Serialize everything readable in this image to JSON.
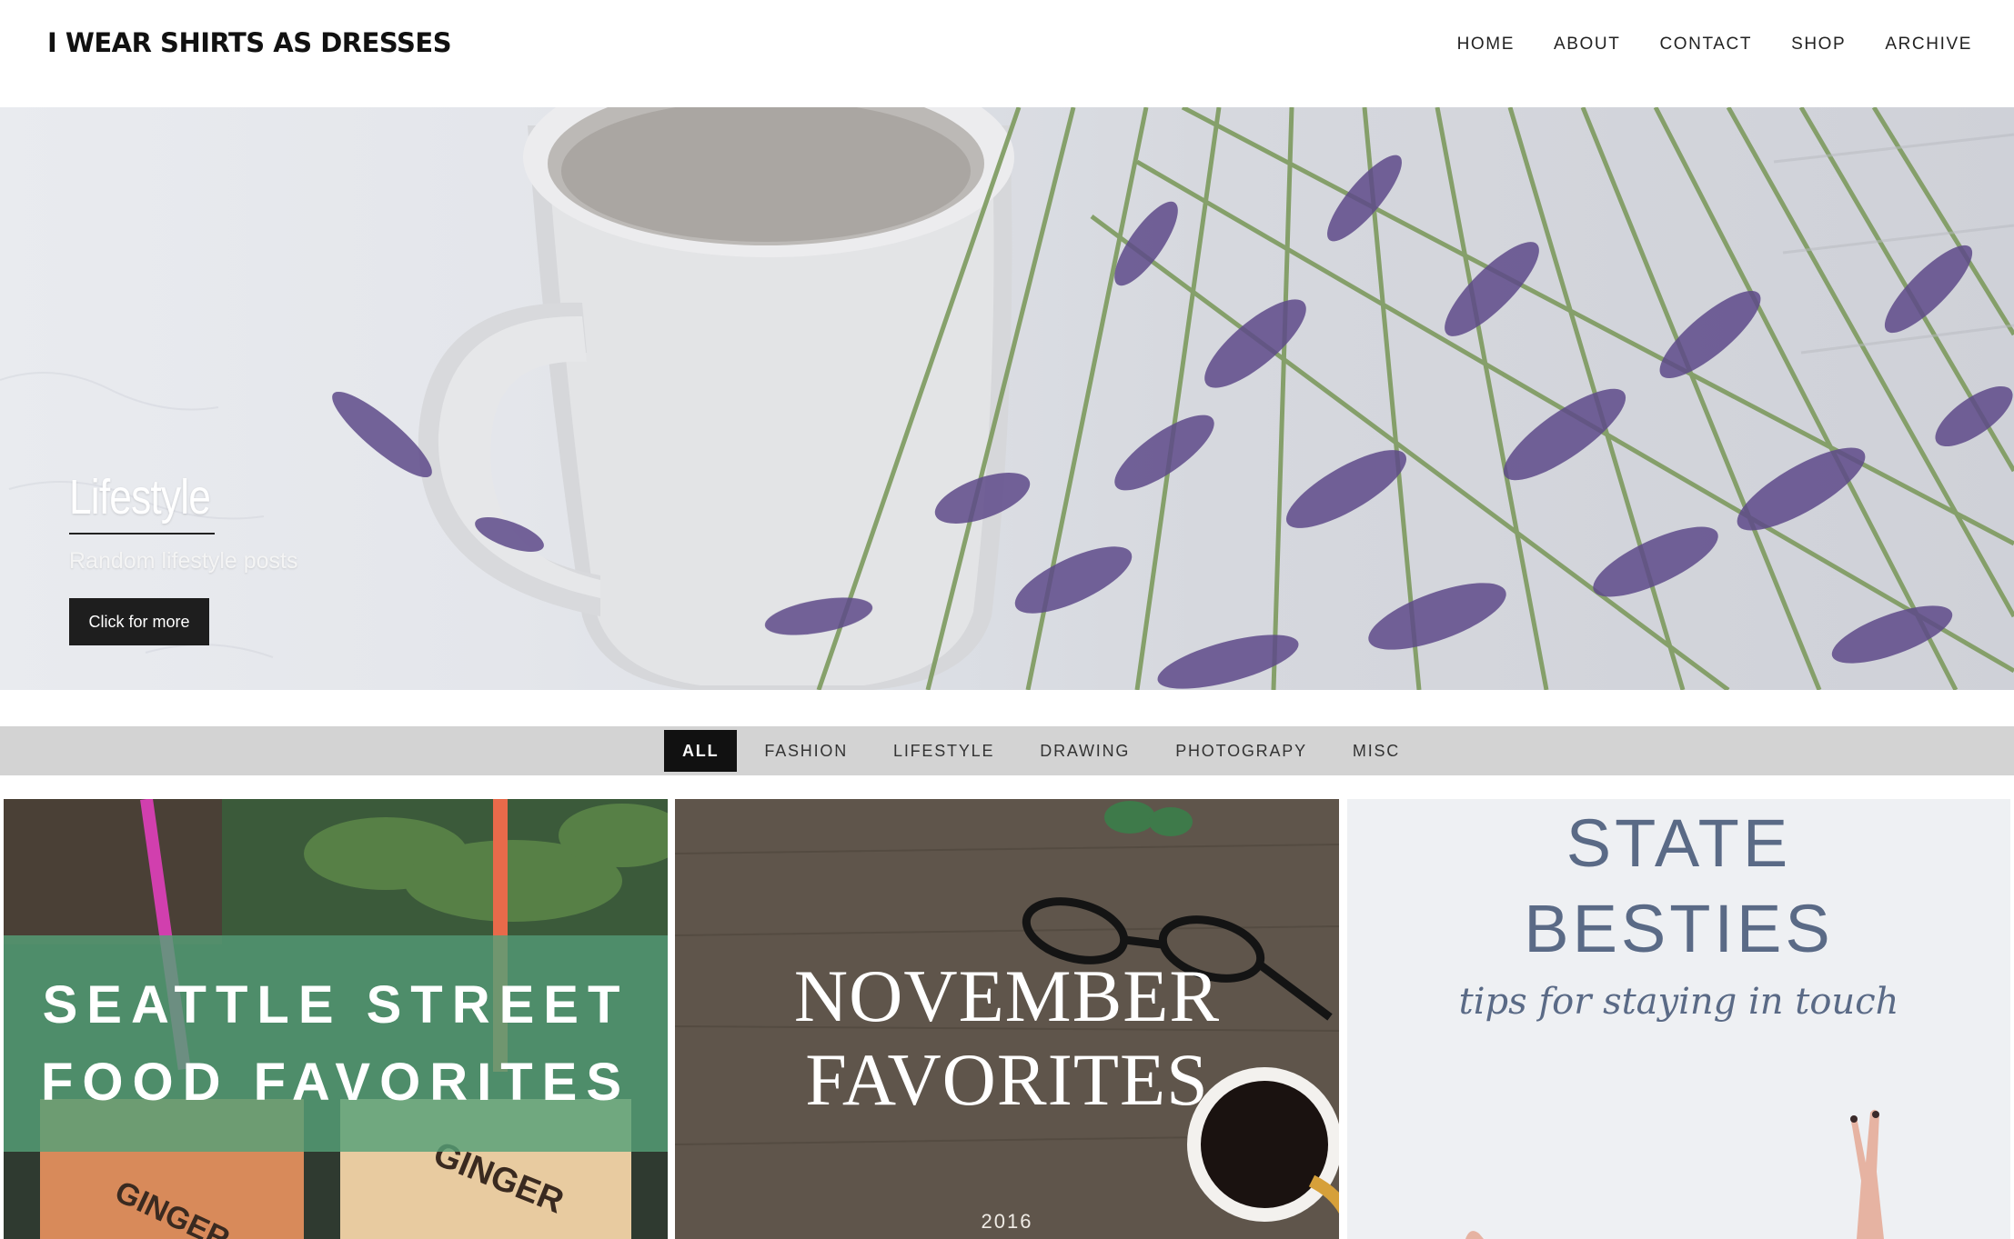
{
  "header": {
    "site_title": "I WEAR SHIRTS AS DRESSES",
    "nav": [
      "HOME",
      "ABOUT",
      "CONTACT",
      "SHOP",
      "ARCHIVE"
    ]
  },
  "hero": {
    "title": "Lifestyle",
    "subtitle": "Random lifestyle posts",
    "button_label": "Click for more"
  },
  "filters": {
    "items": [
      "ALL",
      "FASHION",
      "LIFESTYLE",
      "DRAWING",
      "PHOTOGRAPY",
      "MISC"
    ],
    "active": "ALL"
  },
  "posts": [
    {
      "lines": [
        "SEATTLE STREET",
        "FOOD FAVORITES"
      ],
      "cup_text": [
        "GINGER",
        "GINGER"
      ]
    },
    {
      "lines": [
        "NOVEMBER",
        "FAVORITES"
      ],
      "year": "2016"
    },
    {
      "lines": [
        "STATE",
        "BESTIES"
      ],
      "script": "tips for staying in touch"
    }
  ],
  "colors": {
    "accent_dark": "#111111",
    "filter_bar": "#d3d3d3",
    "band_green": "#56a078",
    "besties_blue": "#5a6a86"
  }
}
